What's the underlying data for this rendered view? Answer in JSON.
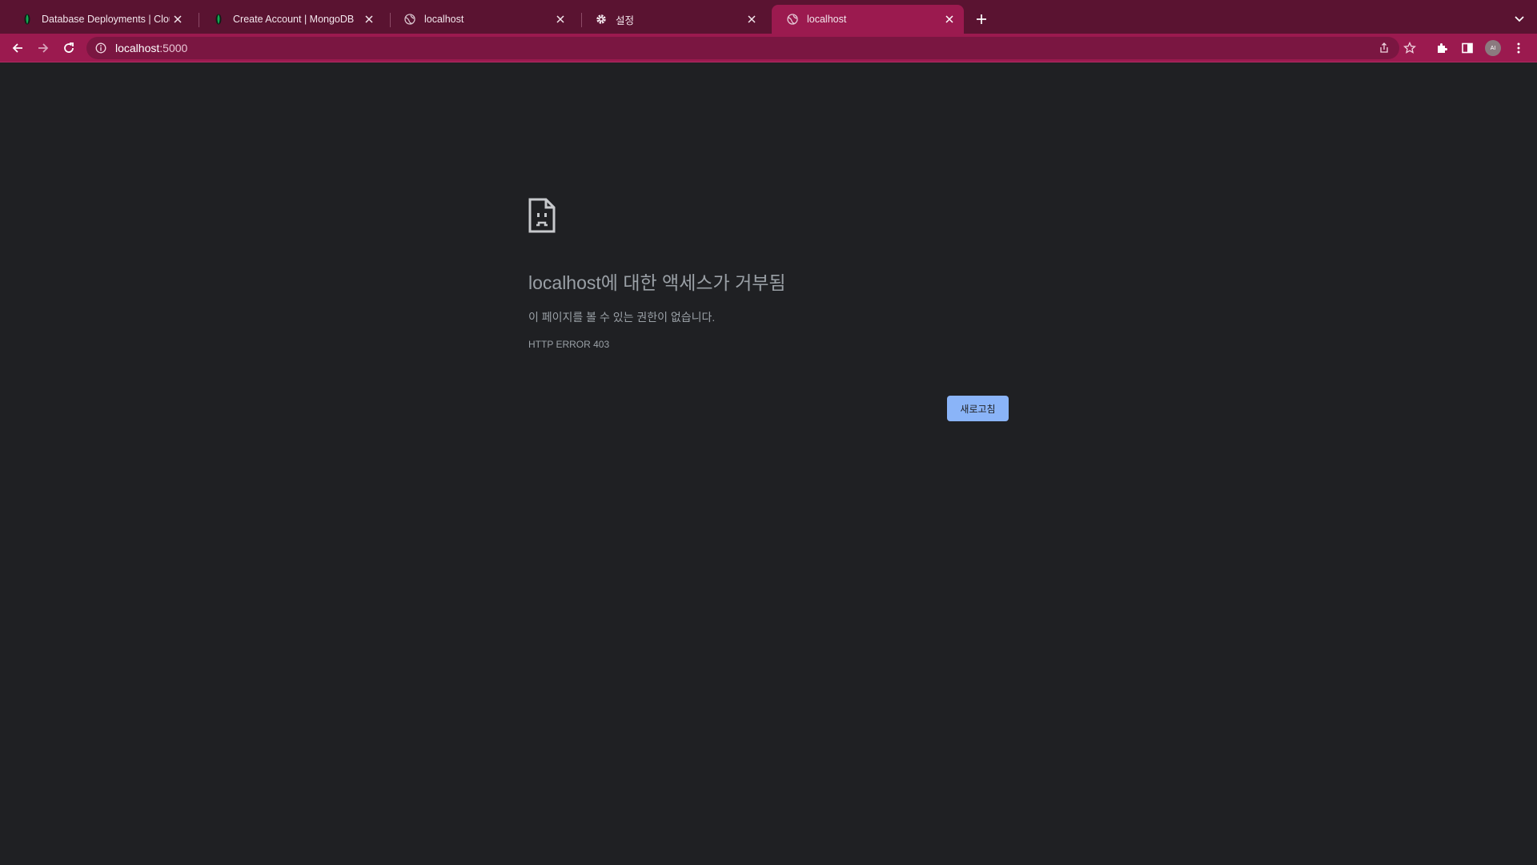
{
  "browser": {
    "tabs": [
      {
        "title": "Database Deployments | Cloud",
        "favicon": "mongodb-leaf-icon",
        "active": false
      },
      {
        "title": "Create Account | MongoDB",
        "favicon": "mongodb-leaf-icon",
        "active": false
      },
      {
        "title": "localhost",
        "favicon": "globe-icon",
        "active": false
      },
      {
        "title": "설정",
        "favicon": "gear-icon",
        "active": false
      },
      {
        "title": "localhost",
        "favicon": "globe-icon",
        "active": true
      }
    ],
    "address": {
      "host": "localhost",
      "port": ":5000"
    },
    "profile_initials": "AI"
  },
  "error_page": {
    "title": "localhost에 대한 액세스가 거부됨",
    "description": "이 페이지를 볼 수 있는 권한이 없습니다.",
    "code": "HTTP ERROR 403",
    "reload_label": "새로고침"
  },
  "colors": {
    "tabstrip": "#5a1331",
    "toolbar": "#9b1a4f",
    "page_background": "#1f2023",
    "button": "#8ab4f8",
    "mongodb_leaf": "#13aa52"
  }
}
